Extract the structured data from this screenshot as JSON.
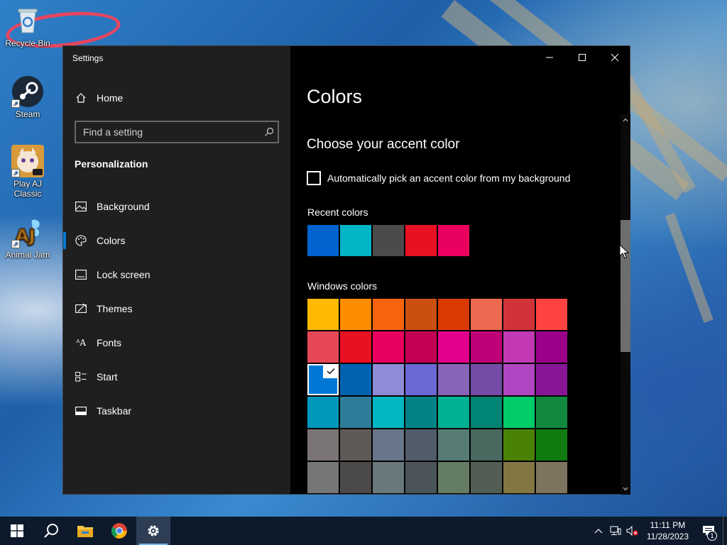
{
  "desktop": {
    "icons": [
      {
        "label": "Recycle Bin"
      },
      {
        "label": "Steam"
      },
      {
        "label": "Play AJ Classic"
      },
      {
        "label": "Animal Jam"
      }
    ]
  },
  "window": {
    "title": "Settings",
    "sidebar": {
      "home_label": "Home",
      "search_placeholder": "Find a setting",
      "section_label": "Personalization",
      "items": [
        {
          "label": "Background",
          "icon": "picture-icon"
        },
        {
          "label": "Colors",
          "icon": "palette-icon",
          "active": true
        },
        {
          "label": "Lock screen",
          "icon": "lock-screen-icon"
        },
        {
          "label": "Themes",
          "icon": "themes-icon"
        },
        {
          "label": "Fonts",
          "icon": "fonts-icon"
        },
        {
          "label": "Start",
          "icon": "start-icon"
        },
        {
          "label": "Taskbar",
          "icon": "taskbar-icon"
        }
      ]
    },
    "content": {
      "page_title": "Colors",
      "subtitle": "Choose your accent color",
      "auto_pick_label": "Automatically pick an accent color from my background",
      "auto_pick_checked": false,
      "recent_label": "Recent colors",
      "recent_colors": [
        "#0063cf",
        "#00b5c6",
        "#4b4b4b",
        "#e81123",
        "#ea005e"
      ],
      "windows_label": "Windows colors",
      "windows_colors": [
        [
          "#ffb900",
          "#ff8c00",
          "#f7630c",
          "#ca5010",
          "#da3b01",
          "#ef6950",
          "#d13438",
          "#ff4343"
        ],
        [
          "#e74856",
          "#e81123",
          "#ea005e",
          "#c30052",
          "#e3008c",
          "#bf0077",
          "#c239b3",
          "#9a0089"
        ],
        [
          "#0078d7",
          "#0063b1",
          "#8e8cd8",
          "#6b69d6",
          "#8764b8",
          "#744da9",
          "#b146c2",
          "#881798"
        ],
        [
          "#0099bc",
          "#2d7d9a",
          "#00b7c3",
          "#038387",
          "#00b294",
          "#018574",
          "#00cc6a",
          "#10893e"
        ],
        [
          "#7a7574",
          "#5d5a58",
          "#68768a",
          "#515c6b",
          "#567c73",
          "#486860",
          "#498205",
          "#107c10"
        ],
        [
          "#767676",
          "#4c4a48",
          "#69797e",
          "#4a5459",
          "#647c64",
          "#525e54",
          "#847545",
          "#7e735f"
        ]
      ],
      "selected_color": "#0078d7"
    }
  },
  "taskbar": {
    "pinned": [
      "windows-start-icon",
      "search-icon",
      "file-explorer-icon",
      "chrome-icon",
      "settings-gear-icon"
    ],
    "time": "11:11 PM",
    "date": "11/28/2023",
    "notification_count": "1"
  },
  "colors": {
    "accent": "#0078d7",
    "sidebar_bg": "#1f1f1f",
    "content_bg": "#000000",
    "taskbar_bg": "#0c1a2c"
  }
}
